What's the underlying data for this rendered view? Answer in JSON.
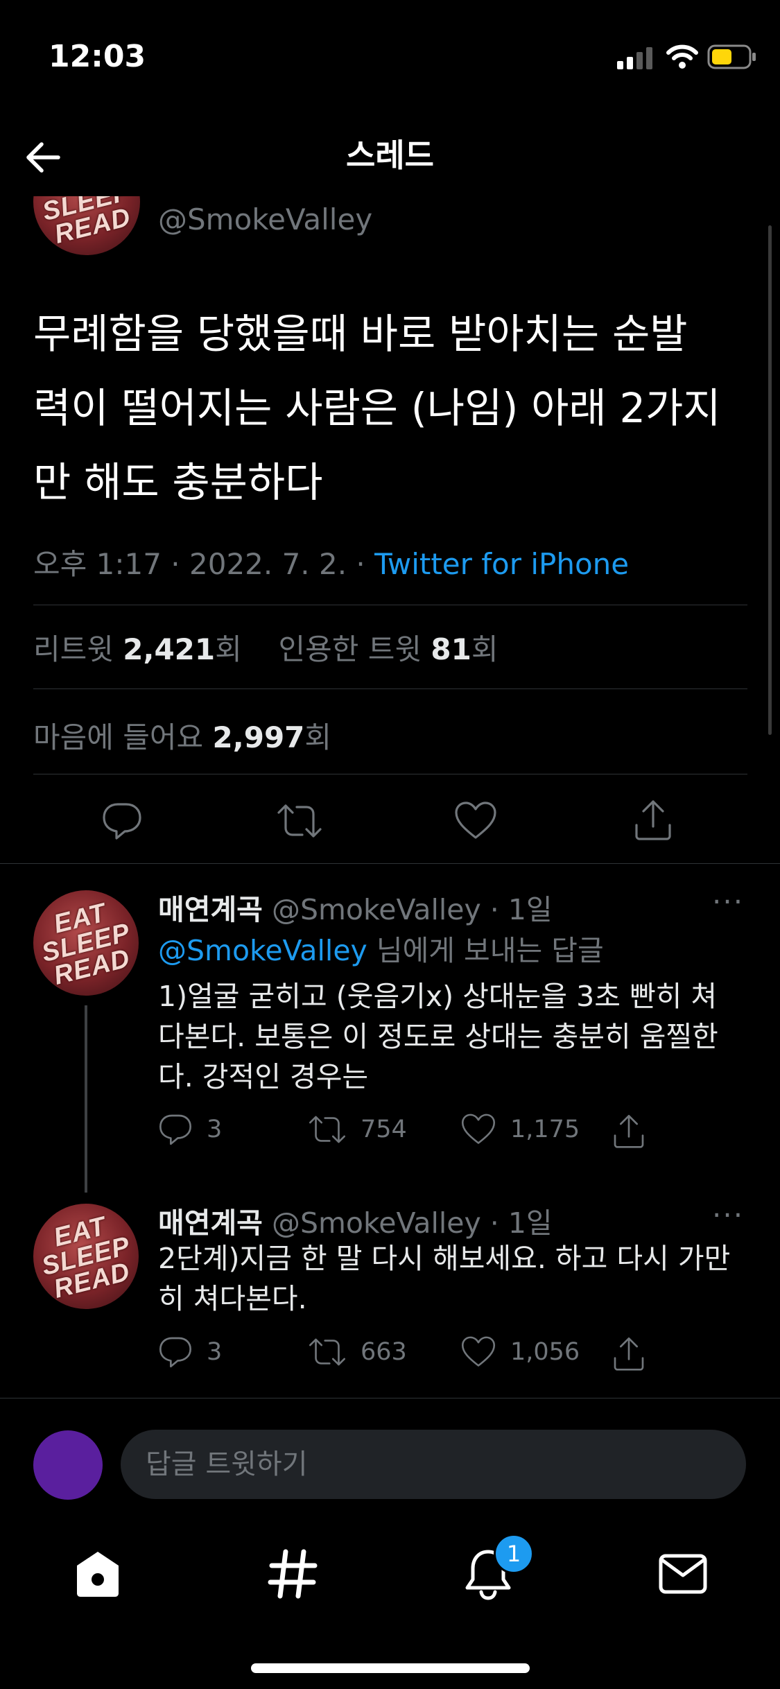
{
  "status_bar": {
    "time": "12:03"
  },
  "header": {
    "title": "스레드"
  },
  "main_tweet": {
    "handle": "@SmokeValley",
    "text": "무례함을 당했을때 바로 받아치는 순발력이 떨어지는 사람은 (나임) 아래 2가지만 해도 충분하다",
    "lines": [
      "무례함을 당했을때 바로 받아치는 순발",
      "력이 떨어지는 사람은 (나임) 아래 2가지",
      "만 해도 충분하다"
    ],
    "time": "오후 1:17 · 2022. 7. 2. · ",
    "source": "Twitter for iPhone",
    "retweets_label": "리트윗 ",
    "retweets": "2,421",
    "retweets_suffix": "회",
    "quotes_label": "인용한 트윗 ",
    "quotes": "81",
    "quotes_suffix": "회",
    "likes_label": "마음에 들어요 ",
    "likes": "2,997",
    "likes_suffix": "회"
  },
  "replies": [
    {
      "name": "매연계곡",
      "handle": "@SmokeValley · 1일",
      "reply_to_handle": "@SmokeValley",
      "reply_to_suffix": " 님에게 보내는 답글",
      "lines": [
        "1)얼굴 굳히고 (웃음기x) 상대눈을 3초 빤히 쳐",
        "다본다. 보통은 이 정도로 상대는 충분히 움찔한",
        "다. 강적인 경우는"
      ],
      "replies_count": "3",
      "retweets_count": "754",
      "likes_count": "1,175"
    },
    {
      "name": "매연계곡",
      "handle": "@SmokeValley · 1일",
      "lines": [
        "2단계)지금 한 말 다시 해보세요. 하고 다시 가만",
        "히 쳐다본다."
      ],
      "replies_count": "3",
      "retweets_count": "663",
      "likes_count": "1,056"
    }
  ],
  "avatar_text": [
    "EAT",
    "SLEEP",
    "READ"
  ],
  "more_label": "···",
  "compose": {
    "placeholder": "답글 트윗하기"
  },
  "tabbar": {
    "notifications_badge": "1"
  },
  "icons": {
    "back": "arrow-left-icon",
    "reply": "reply-icon",
    "retweet": "retweet-icon",
    "like": "heart-icon",
    "share": "share-icon",
    "home": "home-icon",
    "explore": "hashtag-icon",
    "notifications": "bell-icon",
    "messages": "envelope-icon"
  },
  "colors": {
    "background": "#000000",
    "accent": "#1d9bf0",
    "muted": "#71767b",
    "battery": "#ffd60a",
    "compose_avatar": "#5a1f9e"
  }
}
